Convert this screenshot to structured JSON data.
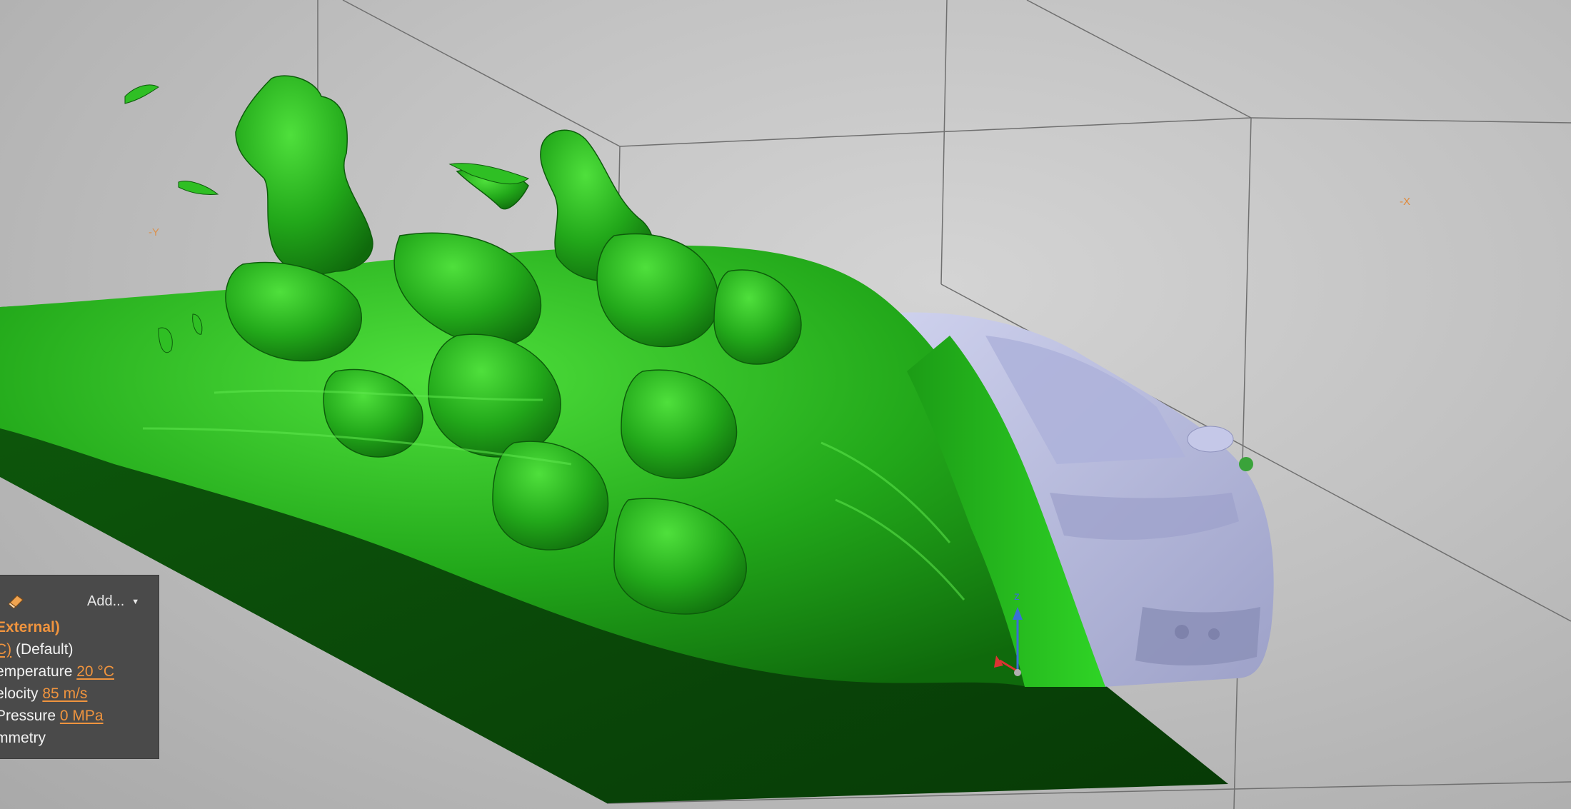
{
  "viewport": {
    "face_label_left": "-Y",
    "face_label_right": "-X",
    "axis_labels": {
      "z": "z"
    },
    "colors": {
      "background": "#c2c2c2",
      "iso_surface": "#2fbf24",
      "iso_surface_dark": "#0f6a0e",
      "ground_plane": "#0b4a0a",
      "car_body": "#b9bde0",
      "bounding_box": "#6a6a6a",
      "accent": "#f0943e"
    }
  },
  "panel": {
    "icon": "eraser-icon",
    "add_label": "Add...",
    "add_icon": "chevron-down-icon",
    "rows": {
      "external": "External)",
      "default_prefix": "C)",
      "default_suffix": " (Default)",
      "temperature_label": "emperature",
      "temperature_value": "20 °C",
      "velocity_label": "elocity",
      "velocity_value": "85 m/s",
      "pressure_label": "Pressure",
      "pressure_value": "0 MPa",
      "symmetry_label": "mmetry"
    }
  }
}
